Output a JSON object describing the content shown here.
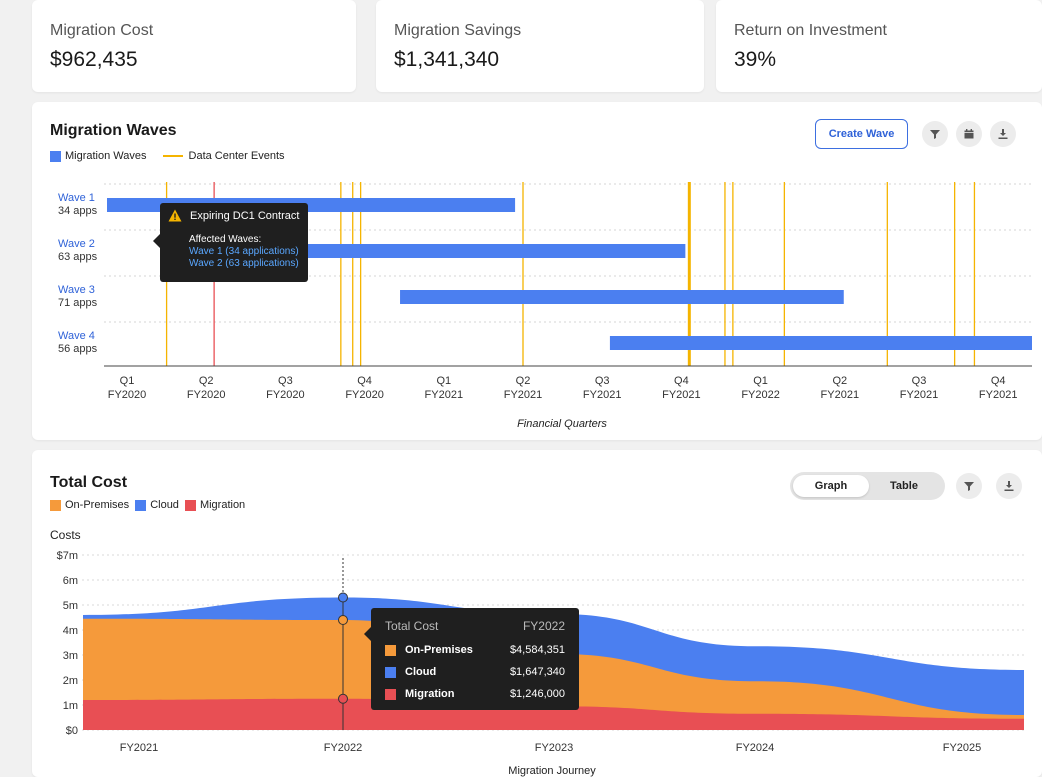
{
  "kpis": {
    "cost": {
      "label": "Migration Cost",
      "value": "$962,435"
    },
    "savings": {
      "label": "Migration Savings",
      "value": "$1,341,340"
    },
    "roi": {
      "label": "Return on Investment",
      "value": "39%"
    }
  },
  "waves": {
    "title": "Migration Waves",
    "legend": {
      "waves": "Migration Waves",
      "events": "Data Center Events"
    },
    "create_button": "Create Wave",
    "items": [
      {
        "name": "Wave 1",
        "apps": "34 apps",
        "start": 0,
        "end": 4.9
      },
      {
        "name": "Wave 2",
        "apps": "63 apps",
        "start": 2.2,
        "end": 7.05
      },
      {
        "name": "Wave 3",
        "apps": "71 apps",
        "start": 3.7,
        "end": 9.05
      },
      {
        "name": "Wave 4",
        "apps": "56 apps",
        "start": 6.35,
        "end": 11.5
      }
    ],
    "events": [
      0.5,
      2.7,
      2.85,
      2.95,
      5.0,
      7.1,
      7.55,
      7.65,
      8.3,
      9.6,
      10.45,
      10.7
    ],
    "highlight_event": 1.1,
    "x_ticks": [
      {
        "q": "Q1",
        "fy": "FY2020"
      },
      {
        "q": "Q2",
        "fy": "FY2020"
      },
      {
        "q": "Q3",
        "fy": "FY2020"
      },
      {
        "q": "Q4",
        "fy": "FY2020"
      },
      {
        "q": "Q1",
        "fy": "FY2021"
      },
      {
        "q": "Q2",
        "fy": "FY2021"
      },
      {
        "q": "Q3",
        "fy": "FY2021"
      },
      {
        "q": "Q4",
        "fy": "FY2021"
      },
      {
        "q": "Q1",
        "fy": "FY2022"
      },
      {
        "q": "Q2",
        "fy": "FY2021"
      },
      {
        "q": "Q3",
        "fy": "FY2021"
      },
      {
        "q": "Q4",
        "fy": "FY2021"
      }
    ],
    "x_title": "Financial Quarters",
    "tooltip": {
      "title": "Expiring DC1 Contract",
      "subtitle": "Affected Waves:",
      "links": [
        "Wave 1 (34 applications)",
        "Wave 2 (63 applications)"
      ]
    }
  },
  "cost": {
    "title": "Total Cost",
    "legend": [
      "On-Premises",
      "Cloud",
      "Migration"
    ],
    "toggle": {
      "graph": "Graph",
      "table": "Table"
    },
    "y_title": "Costs",
    "x_title": "Migration Journey",
    "tooltip": {
      "title": "Total Cost",
      "year": "FY2022",
      "rows": [
        {
          "label": "On-Premises",
          "value": "$4,584,351",
          "color": "#f59a3b"
        },
        {
          "label": "Cloud",
          "value": "$1,647,340",
          "color": "#4b7ff0"
        },
        {
          "label": "Migration",
          "value": "$1,246,000",
          "color": "#e84f54"
        }
      ]
    }
  },
  "colors": {
    "wave_bar": "#4b7ff0",
    "event_line": "#f5b400",
    "highlight_event": "#e84f54",
    "on_premises": "#f59a3b",
    "cloud": "#4b7ff0",
    "migration": "#e84f54"
  },
  "chart_data": {
    "type": "area",
    "title": "Total Cost",
    "ylabel": "Costs",
    "xlabel": "Migration Journey",
    "x": [
      "FY2021",
      "FY2022",
      "FY2023",
      "FY2024",
      "FY2025"
    ],
    "y_ticks": [
      "$0",
      "1m",
      "2m",
      "3m",
      "4m",
      "5m",
      "6m",
      "$7m"
    ],
    "ylim": [
      0,
      7
    ],
    "series": [
      {
        "name": "Migration",
        "values": [
          1.2,
          1.25,
          0.95,
          0.65,
          0.45
        ]
      },
      {
        "name": "On-Premises",
        "values": [
          3.25,
          3.15,
          2.1,
          1.3,
          0.15
        ]
      },
      {
        "name": "Cloud",
        "values": [
          0.15,
          0.9,
          1.6,
          1.4,
          1.8
        ]
      }
    ],
    "stacked": true,
    "highlight_x": "FY2022"
  }
}
